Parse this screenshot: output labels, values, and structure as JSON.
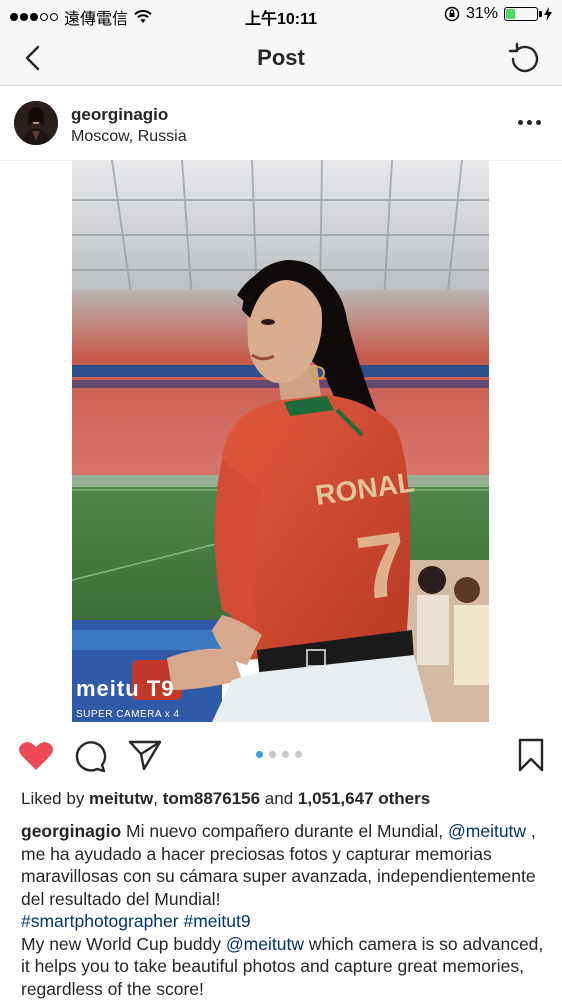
{
  "status_bar": {
    "carrier": "遠傳電信",
    "time": "上午10:11",
    "battery_percent": "31%",
    "battery_level": 0.31,
    "signal_bars_filled": 3,
    "signal_bars_total": 5,
    "battery_fill_color": "#4cd964"
  },
  "nav": {
    "title": "Post",
    "back_icon": "chevron-left-icon",
    "refresh_icon": "refresh-icon"
  },
  "post": {
    "username": "georginagio",
    "location": "Moscow, Russia",
    "more_icon": "more-horizontal-icon",
    "image": {
      "brand_text": "meitu T9",
      "brand_sub": "SUPER CAMERA x 4",
      "jersey_text": "RONAL",
      "jersey_number": "7"
    },
    "carousel_count": 4,
    "carousel_active": 0,
    "likes": {
      "prefix": "Liked by ",
      "user1": "meitutw",
      "sep1": ", ",
      "user2": "tom8876156",
      "sep2": " and ",
      "count": "1,051,647 others"
    },
    "caption": {
      "username": "georginagio",
      "text1": " Mi nuevo compañero durante el Mundial, ",
      "mention1": "@meitutw",
      "text2": " , me ha ayudado a hacer preciosas fotos y capturar memorias maravillosas con su cámara super avanzada, independientemente del resultado del Mundial! ",
      "hashtag1": "#smartphotographer",
      "space": " ",
      "hashtag2": "#meitut9",
      "text3": "My new World Cup buddy ",
      "mention2": "@meitutw",
      "text4": " which camera is so advanced, it helps you to take beautiful photos and capture great memories, regardless of the score!"
    }
  },
  "colors": {
    "like_red": "#ed4956",
    "link_blue": "#003569",
    "dot_active": "#3897f0"
  }
}
